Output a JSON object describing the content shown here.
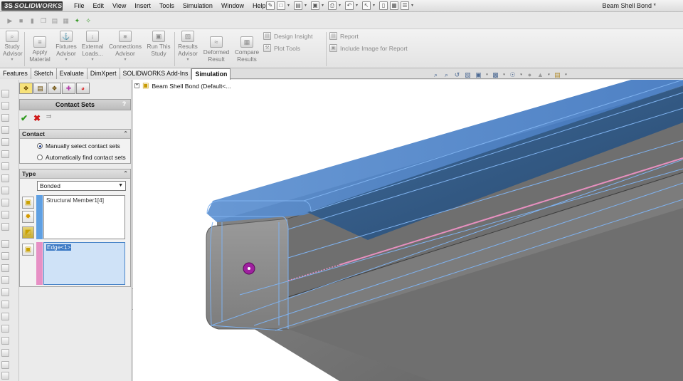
{
  "app": {
    "logo_text": "SOLIDWORKS",
    "logo_ds": "3S",
    "document_title": "Beam Shell Bond *"
  },
  "menu": [
    "File",
    "Edit",
    "View",
    "Insert",
    "Tools",
    "Simulation",
    "Window",
    "Help"
  ],
  "ribbon": {
    "study_advisor": [
      "Study",
      "Advisor"
    ],
    "apply_material": [
      "Apply",
      "Material"
    ],
    "fixtures_advisor": [
      "Fixtures",
      "Advisor"
    ],
    "external_loads": [
      "External",
      "Loads..."
    ],
    "connections_advisor": [
      "Connections",
      "Advisor"
    ],
    "run_study": [
      "Run This",
      "Study"
    ],
    "results_advisor": [
      "Results",
      "Advisor"
    ],
    "deformed_result": [
      "Deformed",
      "Result"
    ],
    "compare_results": [
      "Compare",
      "Results"
    ],
    "design_insight": "Design Insight",
    "plot_tools": "Plot Tools",
    "report": "Report",
    "include_image": "Include Image for Report"
  },
  "tabs": [
    "Features",
    "Sketch",
    "Evaluate",
    "DimXpert",
    "SOLIDWORKS Add-Ins",
    "Simulation"
  ],
  "active_tab": "Simulation",
  "property_manager": {
    "title": "Contact Sets",
    "help": "?",
    "contact_group": {
      "title": "Contact",
      "options": [
        "Manually select contact sets",
        "Automatically find contact sets"
      ],
      "selected_index": 0
    },
    "type_group": {
      "title": "Type",
      "selected_type": "Bonded",
      "set1_items": [
        "Structural Member1[4]"
      ],
      "set2_items": [
        "Edge<1>"
      ]
    }
  },
  "graphics": {
    "tree_root": "Beam Shell Bond  (Default<..."
  },
  "colors": {
    "selection_blue": "#4f86c6",
    "selection_pink": "#e890c0",
    "beam_gray": "#8a8a8a",
    "marker_magenta": "#a020a0",
    "active_tab_bg": "#ffffff"
  }
}
